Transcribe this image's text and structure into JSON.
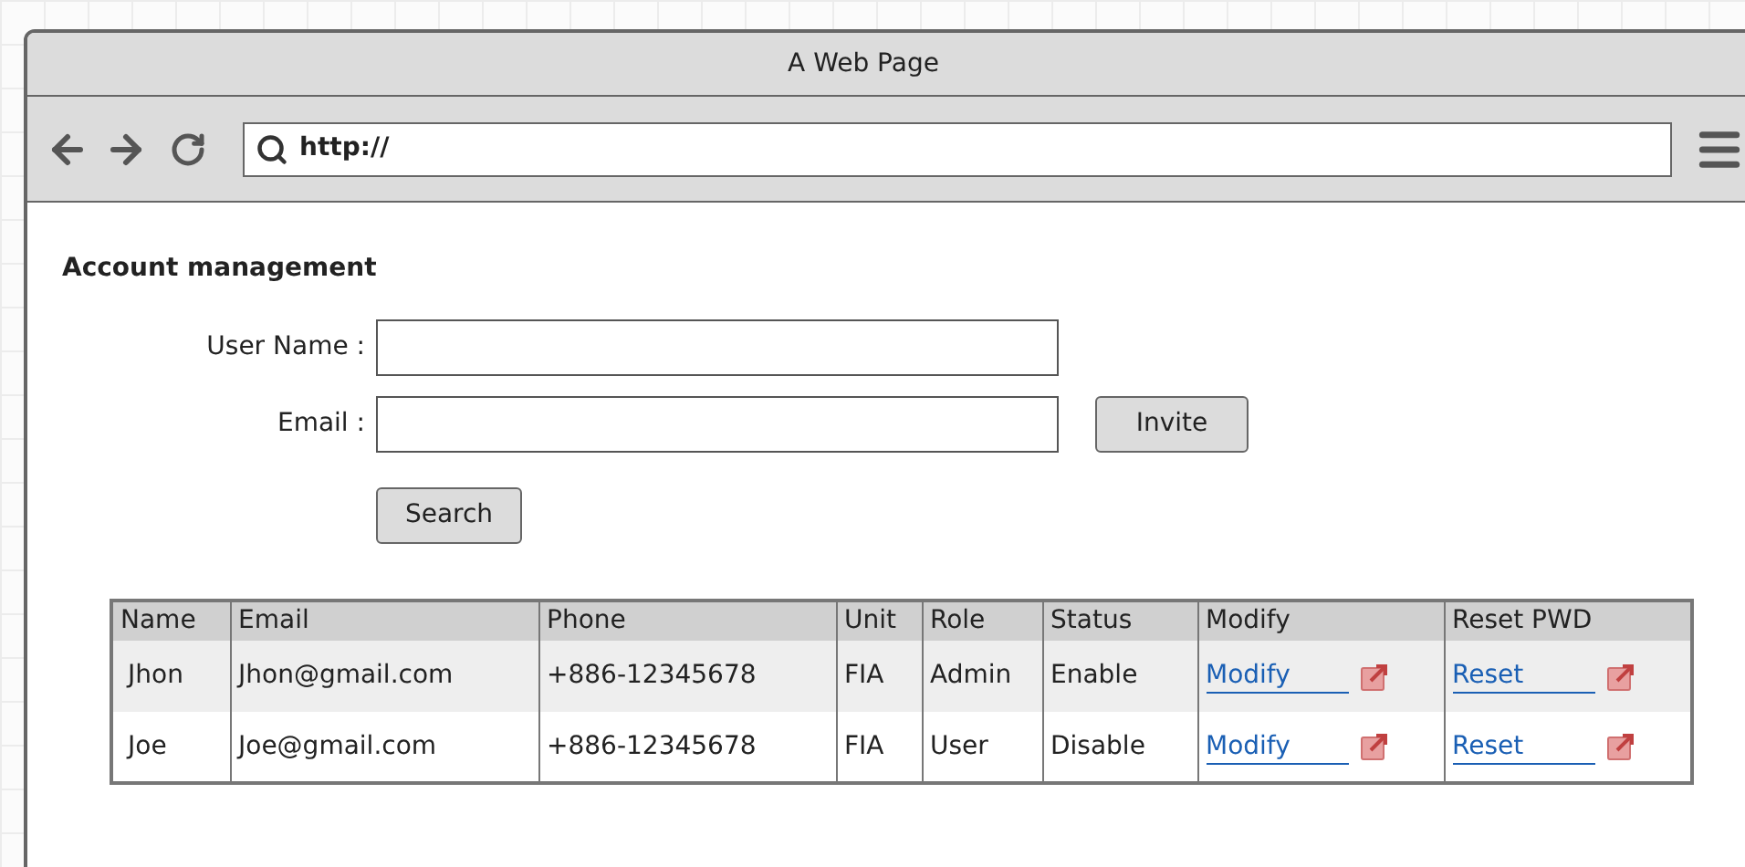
{
  "window": {
    "title": "A Web Page"
  },
  "browser": {
    "url": "http://"
  },
  "heading": "Account management",
  "form": {
    "fields": [
      {
        "label": "User Name :"
      },
      {
        "label": "Email :"
      }
    ],
    "invite_button": "Invite",
    "search_button": "Search"
  },
  "table": {
    "columns": [
      "Name",
      "Email",
      "Phone",
      "Unit",
      "Role",
      "Status",
      "Modify",
      "Reset PWD"
    ],
    "rows": [
      {
        "name": "Jhon",
        "email": "Jhon@gmail.com",
        "phone": "+886-12345678",
        "unit": "FIA",
        "role": "Admin",
        "status": "Enable",
        "modify": "Modify",
        "reset": "Reset"
      },
      {
        "name": "Joe",
        "email": "Joe@gmail.com",
        "phone": "+886-12345678",
        "unit": "FIA",
        "role": "User",
        "status": "Disable",
        "modify": "Modify",
        "reset": "Reset"
      }
    ]
  }
}
